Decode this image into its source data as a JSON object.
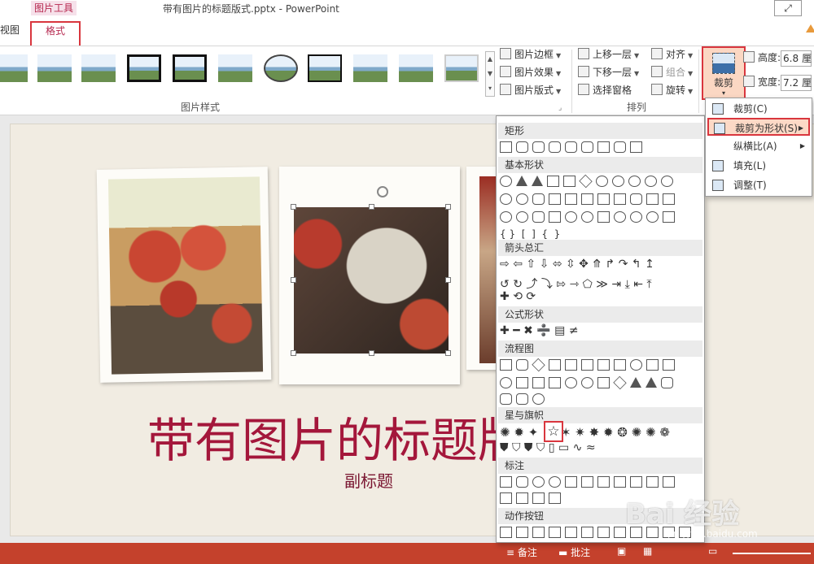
{
  "titlebar": {
    "context_tab": "图片工具",
    "doc_title": "带有图片的标题版式.pptx - PowerPoint",
    "restore_icon": "restore-down-icon"
  },
  "tabs": {
    "view_fragment": "视图",
    "format": "格式"
  },
  "ribbon": {
    "picture_styles_label": "图片样式",
    "picture_border": "图片边框",
    "picture_effects": "图片效果",
    "picture_layout": "图片版式",
    "arrange_label": "排列",
    "bring_forward": "上移一层",
    "send_backward": "下移一层",
    "selection_pane": "选择窗格",
    "align": "对齐",
    "group": "组合",
    "rotate": "旋转",
    "crop": "裁剪",
    "height_label": "高度:",
    "height_value": "6.8 厘",
    "width_label": "宽度:",
    "width_value": "7.2 厘"
  },
  "slide": {
    "title": "带有图片的标题版式",
    "subtitle": "副标题"
  },
  "shape_menu": {
    "categories": [
      "矩形",
      "基本形状",
      "箭头总汇",
      "公式形状",
      "流程图",
      "星与旗帜",
      "标注",
      "动作按钮"
    ],
    "selected_shape": "☆"
  },
  "crop_menu": {
    "crop": "裁剪(C)",
    "crop_to_shape": "裁剪为形状(S)",
    "aspect_ratio": "纵横比(A)",
    "fill": "填充(L)",
    "fit": "调整(T)"
  },
  "statusbar": {
    "notes": "备注",
    "comments": "批注"
  },
  "watermark": {
    "brand": "Bai 经验",
    "url": "jingyan.baidu.com"
  },
  "colors": {
    "accent": "#b6284f",
    "highlight_border": "#d9363e",
    "status_bar": "#c4412c",
    "slide_title": "#a4173b"
  }
}
